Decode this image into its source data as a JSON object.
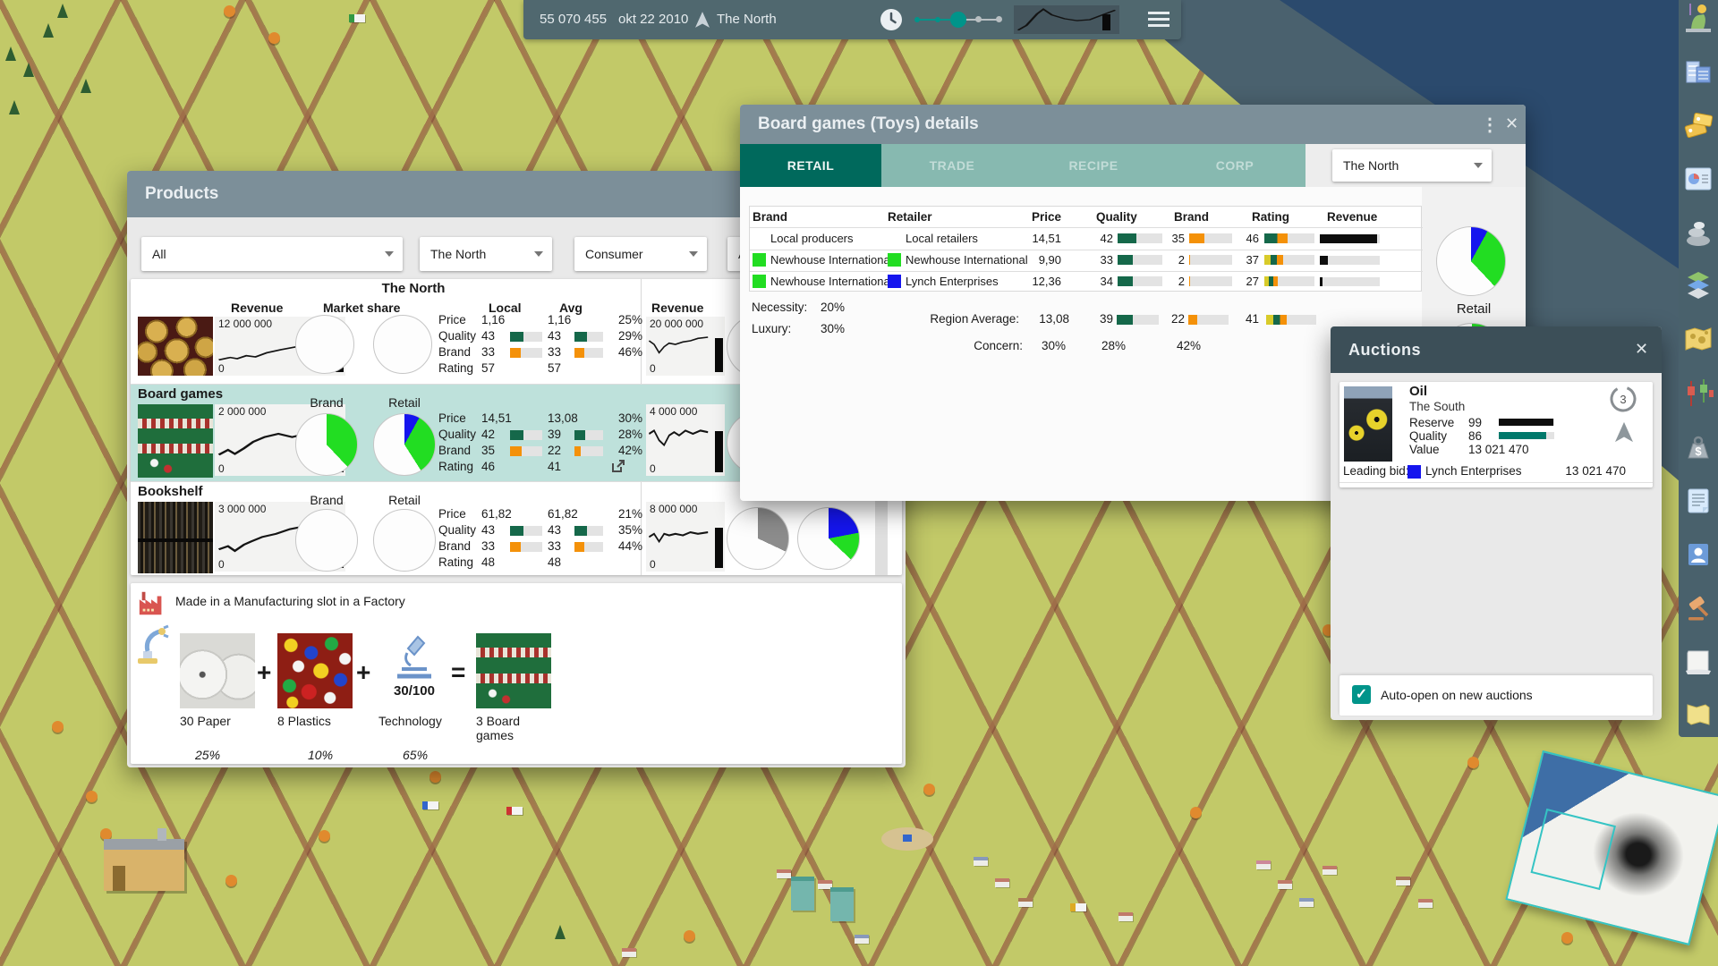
{
  "colors": {
    "accent_teal": "#00695C",
    "tab_inactive": "#87B9B0",
    "window_titlebar": "#7C8F99",
    "auctions_titlebar": "#3C4F58",
    "topbar": "#50686F",
    "sidebar": "#49616C",
    "highlight_row": "#BEE1DB",
    "bar_green": "#15684A",
    "bar_orange": "#F49109",
    "bar_yellow": "#D8CB2A",
    "pie_green": "#22DD22",
    "pie_blue": "#1515EE",
    "pie_gray": "#8C8C8C",
    "checkbox_teal": "#00948A",
    "water": "#2B4A6D",
    "grass": "#C2C968"
  },
  "top_bar": {
    "money": "55 070 455",
    "date": "okt 22 2010",
    "region": "The North"
  },
  "products_window": {
    "title": "Products",
    "filters": [
      {
        "value": "All"
      },
      {
        "value": "The North"
      },
      {
        "value": "Consumer"
      },
      {
        "value": "A"
      }
    ],
    "table": {
      "region_title": "The North",
      "col_revenue": "Revenue",
      "col_market_share": "Market share",
      "col_local": "Local",
      "col_avg": "Avg",
      "col_revenue2": "Revenue",
      "rows": [
        {
          "name": "",
          "revenue_max": "12 000 000",
          "revenue_min": "0",
          "revenue2_max": "20 000 000",
          "revenue2_min": "0",
          "pie_brand_label": "",
          "pie_retail_label": "",
          "pies": {
            "brand": [],
            "retail": [],
            "region2_brand": [],
            "region2_retail": []
          },
          "stats": [
            {
              "label": "Price",
              "local": "1,16",
              "avg": "1,16",
              "pct": "25%"
            },
            {
              "label": "Quality",
              "local": "43",
              "avg": "43",
              "pct": "29%",
              "bar": 43,
              "bar_avg": 43
            },
            {
              "label": "Brand",
              "local": "33",
              "avg": "33",
              "pct": "46%",
              "bar": 33,
              "bar_avg": 33
            },
            {
              "label": "Rating",
              "local": "57",
              "avg": "57",
              "pct": ""
            }
          ]
        },
        {
          "name": "Board games",
          "revenue_max": "2 000 000",
          "revenue_min": "0",
          "revenue2_max": "4 000 000",
          "revenue2_min": "0",
          "pie_brand_label": "Brand",
          "pie_retail_label": "Retail",
          "pies": {
            "brand": [
              {
                "color": "#22DD22",
                "pct": 38
              }
            ],
            "retail": [
              {
                "color": "#1515EE",
                "pct": 8
              },
              {
                "color": "#22DD22",
                "pct": 33
              }
            ],
            "region2_brand": [],
            "region2_retail": []
          },
          "stats": [
            {
              "label": "Price",
              "local": "14,51",
              "avg": "13,08",
              "pct": "30%"
            },
            {
              "label": "Quality",
              "local": "42",
              "avg": "39",
              "pct": "28%",
              "bar": 42,
              "bar_avg": 39
            },
            {
              "label": "Brand",
              "local": "35",
              "avg": "22",
              "pct": "42%",
              "bar": 35,
              "bar_avg": 22
            },
            {
              "label": "Rating",
              "local": "46",
              "avg": "41",
              "pct": ""
            }
          ]
        },
        {
          "name": "Bookshelf",
          "revenue_max": "3 000 000",
          "revenue_min": "0",
          "revenue2_max": "8 000 000",
          "revenue2_min": "0",
          "pie_brand_label": "Brand",
          "pie_retail_label": "Retail",
          "pies": {
            "brand": [],
            "retail": [],
            "region2_brand": [
              {
                "color": "#8C8C8C",
                "pct": 32
              }
            ],
            "region2_retail": [
              {
                "color": "#1515EE",
                "pct": 22
              },
              {
                "color": "#22DD22",
                "pct": 15
              }
            ]
          },
          "stats": [
            {
              "label": "Price",
              "local": "61,82",
              "avg": "61,82",
              "pct": "21%"
            },
            {
              "label": "Quality",
              "local": "43",
              "avg": "43",
              "pct": "35%",
              "bar": 43,
              "bar_avg": 43
            },
            {
              "label": "Brand",
              "local": "33",
              "avg": "33",
              "pct": "44%",
              "bar": 33,
              "bar_avg": 33
            },
            {
              "label": "Rating",
              "local": "48",
              "avg": "48",
              "pct": ""
            }
          ]
        }
      ]
    },
    "recipe": {
      "note": "Made in a Manufacturing slot in a Factory",
      "plus": "+",
      "equals": "=",
      "tech_value": "30/100",
      "inputs": [
        {
          "label": "30 Paper",
          "share": "25%"
        },
        {
          "label": "8 Plastics",
          "share": "10%"
        },
        {
          "label": "Technology",
          "share": "65%"
        }
      ],
      "output_label": "3 Board games"
    }
  },
  "details_window": {
    "title": "Board games (Toys) details",
    "tabs": [
      {
        "label": "RETAIL",
        "active": true
      },
      {
        "label": "TRADE",
        "active": false
      },
      {
        "label": "RECIPE",
        "active": false
      },
      {
        "label": "CORP",
        "active": false
      }
    ],
    "region_selector": {
      "value": "The North"
    },
    "table": {
      "headers": {
        "brand": "Brand",
        "retailer": "Retailer",
        "price": "Price",
        "quality": "Quality",
        "brand2": "Brand",
        "rating": "Rating",
        "revenue": "Revenue"
      },
      "rows": [
        {
          "brand": "Local producers",
          "retailer": "Local retailers",
          "price": "14,51",
          "quality": "42",
          "brand_val": "35",
          "rating": "46",
          "revenue_pct": 95
        },
        {
          "brand": "Newhouse International",
          "brand_color": "#22DD22",
          "retailer": "Newhouse International",
          "retailer_color": "#22DD22",
          "price": "9,90",
          "quality": "33",
          "brand_val": "2",
          "rating": "37",
          "revenue_pct": 13
        },
        {
          "brand": "Newhouse International",
          "brand_color": "#22DD22",
          "retailer": "Lynch Enterprises",
          "retailer_color": "#1515EE",
          "price": "12,36",
          "quality": "34",
          "brand_val": "2",
          "rating": "27",
          "revenue_pct": 5
        }
      ]
    },
    "summary": {
      "necessity_label": "Necessity:",
      "necessity_value": "20%",
      "luxury_label": "Luxury:",
      "luxury_value": "30%",
      "region_average_label": "Region Average:",
      "region_average_price": "13,08",
      "region_average_quality": "39",
      "region_average_brand": "22",
      "region_average_rating": "41",
      "concern_label": "Concern:",
      "concern_price": "30%",
      "concern_quality": "28%",
      "concern_brand": "42%"
    },
    "pies": {
      "retail_label": "Retail",
      "retail": [
        {
          "color": "#1515EE",
          "pct": 8
        },
        {
          "color": "#22DD22",
          "pct": 30
        }
      ],
      "brand_partial": [
        {
          "color": "#22DD22",
          "pct": 50
        }
      ]
    }
  },
  "auctions_window": {
    "title": "Auctions",
    "item": {
      "name": "Oil",
      "region": "The South",
      "reserve_label": "Reserve",
      "reserve": "99",
      "quality_label": "Quality",
      "quality": "86",
      "value_label": "Value",
      "value": "13 021 470",
      "timer": "3",
      "leading_label": "Leading bid:",
      "bidder": "Lynch Enterprises",
      "bidder_color": "#1515EE",
      "bid": "13 021 470"
    },
    "auto_open_label": "Auto-open on new auctions",
    "auto_open_checked": true
  },
  "sidebar": {
    "items": [
      {
        "icon": "statue-icon"
      },
      {
        "icon": "headquarters-icon"
      },
      {
        "icon": "products-tags-icon"
      },
      {
        "icon": "reports-icon"
      },
      {
        "icon": "resources-icon"
      },
      {
        "icon": "terrain-layers-icon"
      },
      {
        "icon": "world-map-icon"
      },
      {
        "icon": "stock-market-icon"
      },
      {
        "icon": "finance-icon"
      },
      {
        "icon": "notes-icon"
      },
      {
        "icon": "contacts-icon"
      },
      {
        "icon": "auctions-icon"
      },
      {
        "icon": "newspaper-icon"
      },
      {
        "icon": "region-map-icon"
      }
    ]
  }
}
